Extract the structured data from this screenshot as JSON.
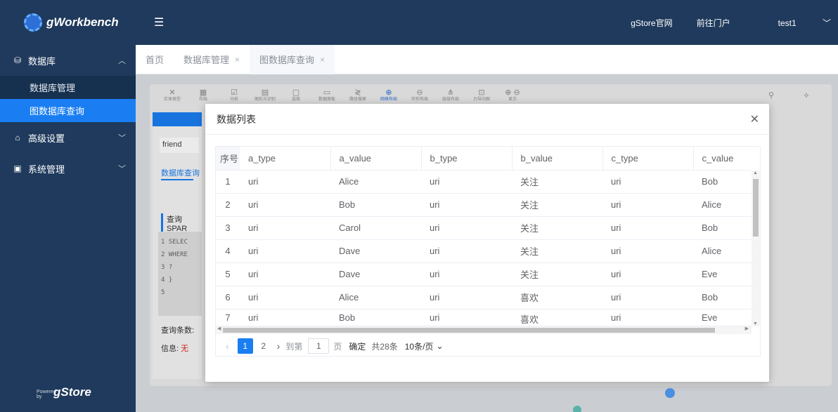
{
  "sidebar": {
    "logo": "gWorkbench",
    "groups": [
      {
        "icon": "database-icon",
        "label": "数据库",
        "expanded": true,
        "items": [
          {
            "label": "数据库管理"
          },
          {
            "label": "图数据库查询",
            "active": true
          }
        ]
      },
      {
        "icon": "advanced-settings-icon",
        "label": "高级设置",
        "expanded": false
      },
      {
        "icon": "system-management-icon",
        "label": "系统管理",
        "expanded": false
      }
    ],
    "powered_small": "Powered by",
    "powered_brand": "gStore"
  },
  "topbar": {
    "links": [
      "gStore官网",
      "前往门户"
    ],
    "user": "test1"
  },
  "tabs": [
    {
      "label": "首页",
      "closable": false
    },
    {
      "label": "数据库管理",
      "closable": true
    },
    {
      "label": "图数据库查询",
      "closable": true,
      "current": true
    }
  ],
  "background": {
    "toolbar": [
      "实体类型",
      "布局",
      "分析",
      "图形元识别",
      "选择",
      "数据面板",
      "路径搜索",
      "网格布局",
      "环形布局",
      "层级布局",
      "力导向图",
      "显示",
      "隐藏"
    ],
    "friend": "friend",
    "tab_link": "数据库查询",
    "sparql_title": "查询SPAR",
    "code_lines": [
      "1 SELEC",
      "2 WHERE",
      "3     ?",
      "4 }",
      "5"
    ],
    "query_count_label": "查询条数:",
    "info_label": "信息:",
    "info_value": "无"
  },
  "modal": {
    "title": "数据列表",
    "columns": [
      "序号",
      "a_type",
      "a_value",
      "b_type",
      "b_value",
      "c_type",
      "c_value"
    ],
    "rows": [
      [
        "1",
        "uri",
        "Alice",
        "uri",
        "关注",
        "uri",
        "Bob"
      ],
      [
        "2",
        "uri",
        "Bob",
        "uri",
        "关注",
        "uri",
        "Alice"
      ],
      [
        "3",
        "uri",
        "Carol",
        "uri",
        "关注",
        "uri",
        "Bob"
      ],
      [
        "4",
        "uri",
        "Dave",
        "uri",
        "关注",
        "uri",
        "Alice"
      ],
      [
        "5",
        "uri",
        "Dave",
        "uri",
        "关注",
        "uri",
        "Eve"
      ],
      [
        "6",
        "uri",
        "Alice",
        "uri",
        "喜欢",
        "uri",
        "Bob"
      ],
      [
        "7",
        "uri",
        "Bob",
        "uri",
        "喜欢",
        "uri",
        "Eve"
      ]
    ],
    "pagination": {
      "current_page": "1",
      "pages": [
        "1",
        "2"
      ],
      "goto_label": "到第",
      "goto_value": "1",
      "page_unit": "页",
      "confirm_label": "确定",
      "total_label": "共28条",
      "page_size_label": "10条/页"
    }
  },
  "colors": {
    "sidebar_bg": "#1f3a5c",
    "accent": "#1a7ef2",
    "info_red": "#e02020"
  }
}
